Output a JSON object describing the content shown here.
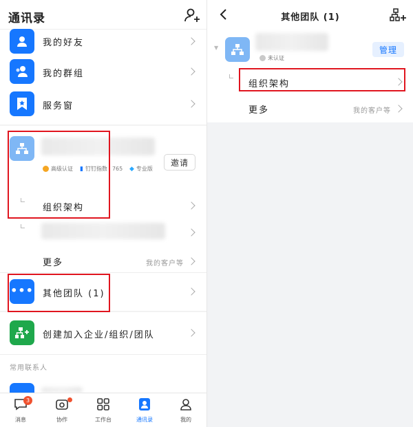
{
  "left": {
    "title": "通讯录",
    "items": [
      {
        "label": "我的好友"
      },
      {
        "label": "我的群组"
      },
      {
        "label": "服务窗"
      }
    ],
    "org": {
      "tags": [
        {
          "text": "高级认证",
          "color": "#f5a623"
        },
        {
          "text": "钉钉指数",
          "color": "#1677ff"
        },
        {
          "text": "765",
          "color": "#999999"
        },
        {
          "text": "专业版",
          "color": "#2aa9ff"
        }
      ],
      "invite_label": "邀请",
      "org_structure_label": "组织架构",
      "more_label": "更多",
      "more_hint": "我的客户等"
    },
    "other_teams_label": "其他团队 (1)",
    "create_join_label": "创建加入企业/组织/团队",
    "section_header": "常用联系人",
    "tabs": [
      {
        "label": "消息",
        "badge": "3"
      },
      {
        "label": "协作"
      },
      {
        "label": "工作台"
      },
      {
        "label": "通讯录"
      },
      {
        "label": "我的"
      }
    ]
  },
  "right": {
    "title": "其他团队 (1)",
    "unverified_label": "未认证",
    "manage_label": "管理",
    "org_structure_label": "组织架构",
    "more_label": "更多",
    "more_hint": "我的客户等"
  },
  "colors": {
    "accent": "#1677ff",
    "green": "#1fa84c",
    "highlight": "#e0141e"
  }
}
